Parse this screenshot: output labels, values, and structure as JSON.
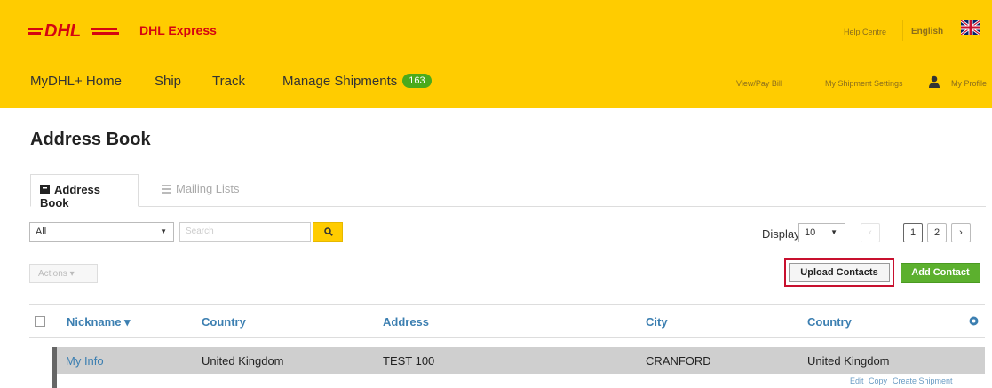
{
  "header": {
    "logo_text": "DHL",
    "brand": "DHL Express",
    "help_centre": "Help Centre",
    "language": "English"
  },
  "nav": {
    "home": "MyDHL+ Home",
    "ship": "Ship",
    "track": "Track",
    "manage": "Manage Shipments",
    "manage_count": "163",
    "view_pay_bill": "View/Pay Bill",
    "shipment_settings": "My Shipment Settings",
    "profile": "My Profile"
  },
  "page": {
    "title": "Address Book"
  },
  "tabs": [
    {
      "label": "Address Book",
      "icon": "book-icon",
      "active": true
    },
    {
      "label": "Mailing Lists",
      "icon": "list-icon",
      "active": false
    }
  ],
  "filter": {
    "selected": "All",
    "search_placeholder": "Search"
  },
  "display": {
    "label": "Display",
    "selected": "10"
  },
  "pagination": {
    "prev": "‹",
    "pages": [
      "1",
      "2"
    ],
    "current": "1",
    "next": "›"
  },
  "toolbar": {
    "actions_label": "Actions ▾",
    "upload_label": "Upload Contacts",
    "add_label": "Add Contact"
  },
  "table": {
    "columns": [
      "Nickname ▾",
      "Country",
      "Address",
      "City",
      "Country"
    ],
    "rows": [
      {
        "nickname": "My Info",
        "country": "United Kingdom",
        "address": "TEST 100",
        "city": "CRANFORD",
        "country2": "United Kingdom",
        "actions": [
          "Edit",
          "Copy",
          "Create Shipment"
        ]
      }
    ]
  },
  "colors": {
    "brand_yellow": "#ffcc00",
    "brand_red": "#d40511",
    "link_blue": "#3c7fb1",
    "add_green": "#5cb02e",
    "highlight_red": "#c8102e"
  }
}
